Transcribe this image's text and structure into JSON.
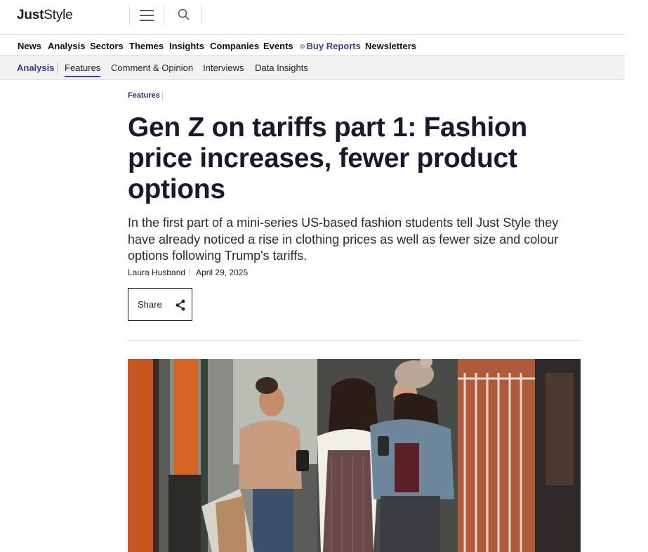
{
  "brand": {
    "name_bold": "Just",
    "name_regular": "Style"
  },
  "header": {
    "menu_icon": "hamburger-menu-icon",
    "search_icon": "search-icon"
  },
  "main_nav": {
    "items": [
      "News",
      "Analysis",
      "Sectors",
      "Themes",
      "Insights",
      "Companies",
      "Events"
    ],
    "buy_reports": "Buy Reports",
    "newsletters": "Newsletters"
  },
  "sub_nav": {
    "section": "Analysis",
    "items": [
      "Features",
      "Comment & Opinion",
      "Interviews",
      "Data Insights"
    ],
    "active": "Features"
  },
  "article": {
    "category": "Features",
    "headline": "Gen Z on tariffs part 1: Fashion price increases, fewer product options",
    "standfirst": "In the first part of a mini-series US-based fashion students tell Just Style they have already noticed a rise in clothing prices as well as fewer size and colour options following Trump's tariffs.",
    "author": "Laura Husband",
    "date": "April 29, 2025",
    "share_label": "Share",
    "share_icon": "share-icon"
  },
  "colors": {
    "accent": "#3b3f8f",
    "text_dark": "#171a2c",
    "subnav_bg": "#f2f2f2"
  }
}
